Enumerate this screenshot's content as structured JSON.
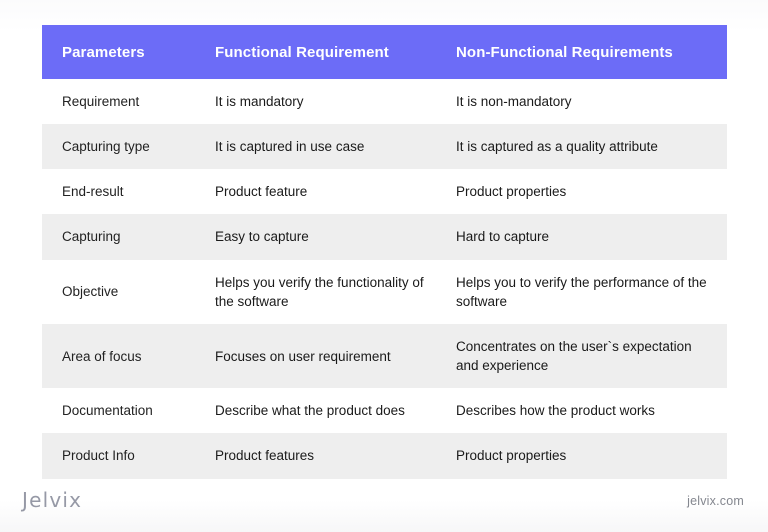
{
  "table": {
    "headers": [
      "Parameters",
      "Functional Requirement",
      "Non-Functional Requirements"
    ],
    "header_bg": "#6c6cf7",
    "header_text_color": "#ffffff",
    "stripe_bg": "#eeeeee",
    "rows": [
      {
        "parameter": "Requirement",
        "functional": "It is mandatory",
        "non_functional": "It is non-mandatory"
      },
      {
        "parameter": "Capturing type",
        "functional": "It is captured in use case",
        "non_functional": "It is captured as a quality attribute"
      },
      {
        "parameter": "End-result",
        "functional": "Product feature",
        "non_functional": "Product properties"
      },
      {
        "parameter": "Capturing",
        "functional": "Easy to capture",
        "non_functional": "Hard to capture"
      },
      {
        "parameter": "Objective",
        "functional": "Helps you verify the functionality of the software",
        "non_functional": "Helps you to verify the performance of the software"
      },
      {
        "parameter": "Area of focus",
        "functional": "Focuses on user requirement",
        "non_functional": "Concentrates on the user`s expectation and experience"
      },
      {
        "parameter": "Documentation",
        "functional": "Describe what the product does",
        "non_functional": "Describes how the product works"
      },
      {
        "parameter": "Product Info",
        "functional": "Product features",
        "non_functional": "Product properties"
      }
    ]
  },
  "footer": {
    "logo_text": "Jelvix",
    "url_text": "jelvix.com"
  }
}
